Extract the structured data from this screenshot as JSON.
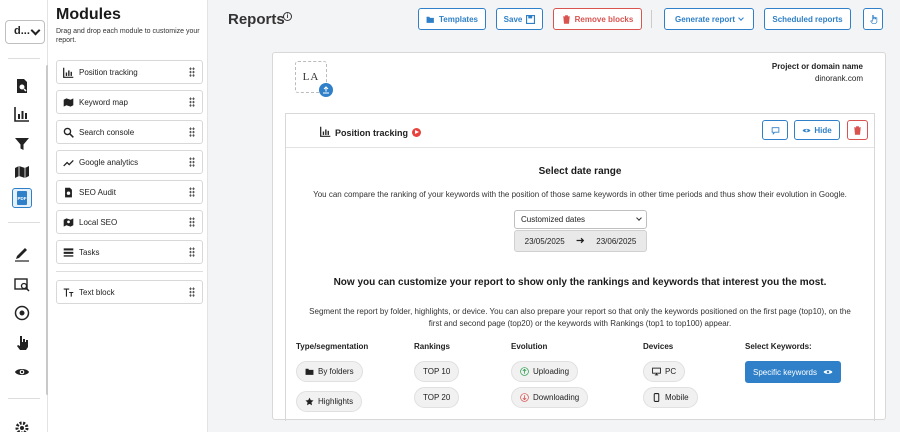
{
  "rail": {
    "project_select": "d...",
    "icons": [
      "document-search-icon",
      "bar-chart-icon",
      "filter-icon",
      "map-icon",
      "pdf-icon",
      "pen-icon",
      "image-search-icon",
      "location-icon",
      "hand-pointer-icon",
      "eye-icon",
      "settings-icon"
    ]
  },
  "modules": {
    "title": "Modules",
    "hint": "Drag and drop each module to customize your report.",
    "items": [
      {
        "label": "Position tracking",
        "icon": "bar-chart-icon"
      },
      {
        "label": "Keyword map",
        "icon": "map-icon"
      },
      {
        "label": "Search console",
        "icon": "search-icon"
      },
      {
        "label": "Google analytics",
        "icon": "trend-icon"
      },
      {
        "label": "SEO Audit",
        "icon": "document-search-icon"
      },
      {
        "label": "Local SEO",
        "icon": "map-pin-icon"
      },
      {
        "label": "Tasks",
        "icon": "list-icon"
      },
      {
        "label": "Text block",
        "icon": "text-icon"
      }
    ]
  },
  "header": {
    "title": "Reports",
    "templates": "Templates",
    "save": "Save",
    "remove_blocks": "Remove blocks",
    "generate_report": "Generate report",
    "scheduled_reports": "Scheduled reports"
  },
  "report": {
    "logo_text": "LA",
    "project_label": "Project or domain name",
    "project_domain": "dinorank.com",
    "block": {
      "title": "Position tracking",
      "hide_label": "Hide",
      "date_title": "Select date range",
      "date_text": "You can compare the ranking of your keywords with the position of those same keywords in other time periods and thus show their evolution in Google.",
      "date_option": "Customized dates",
      "date_from": "23/05/2025",
      "date_to": "23/06/2025",
      "customize_title": "Now you can customize your report to show only the rankings and keywords that interest you the most.",
      "customize_text": "Segment the report by folder, highlights, or device. You can also prepare your report so that only the keywords positioned on the first page (top10), on the first and second page (top20) or the keywords with Rankings (top1 to top100) appear.",
      "columns": {
        "type": "Type/segmentation",
        "rankings": "Rankings",
        "evolution": "Evolution",
        "devices": "Devices",
        "keywords": "Select Keywords:"
      },
      "type_options": [
        "By folders",
        "Highlights"
      ],
      "ranking_options": [
        "TOP 10",
        "TOP 20"
      ],
      "evolution_options": [
        "Uploading",
        "Downloading"
      ],
      "device_options": [
        "PC",
        "Mobile"
      ],
      "keywords_button": "Specific keywords"
    }
  },
  "colors": {
    "accent": "#2f80c8",
    "danger": "#d9534f",
    "play": "#e8423c"
  }
}
